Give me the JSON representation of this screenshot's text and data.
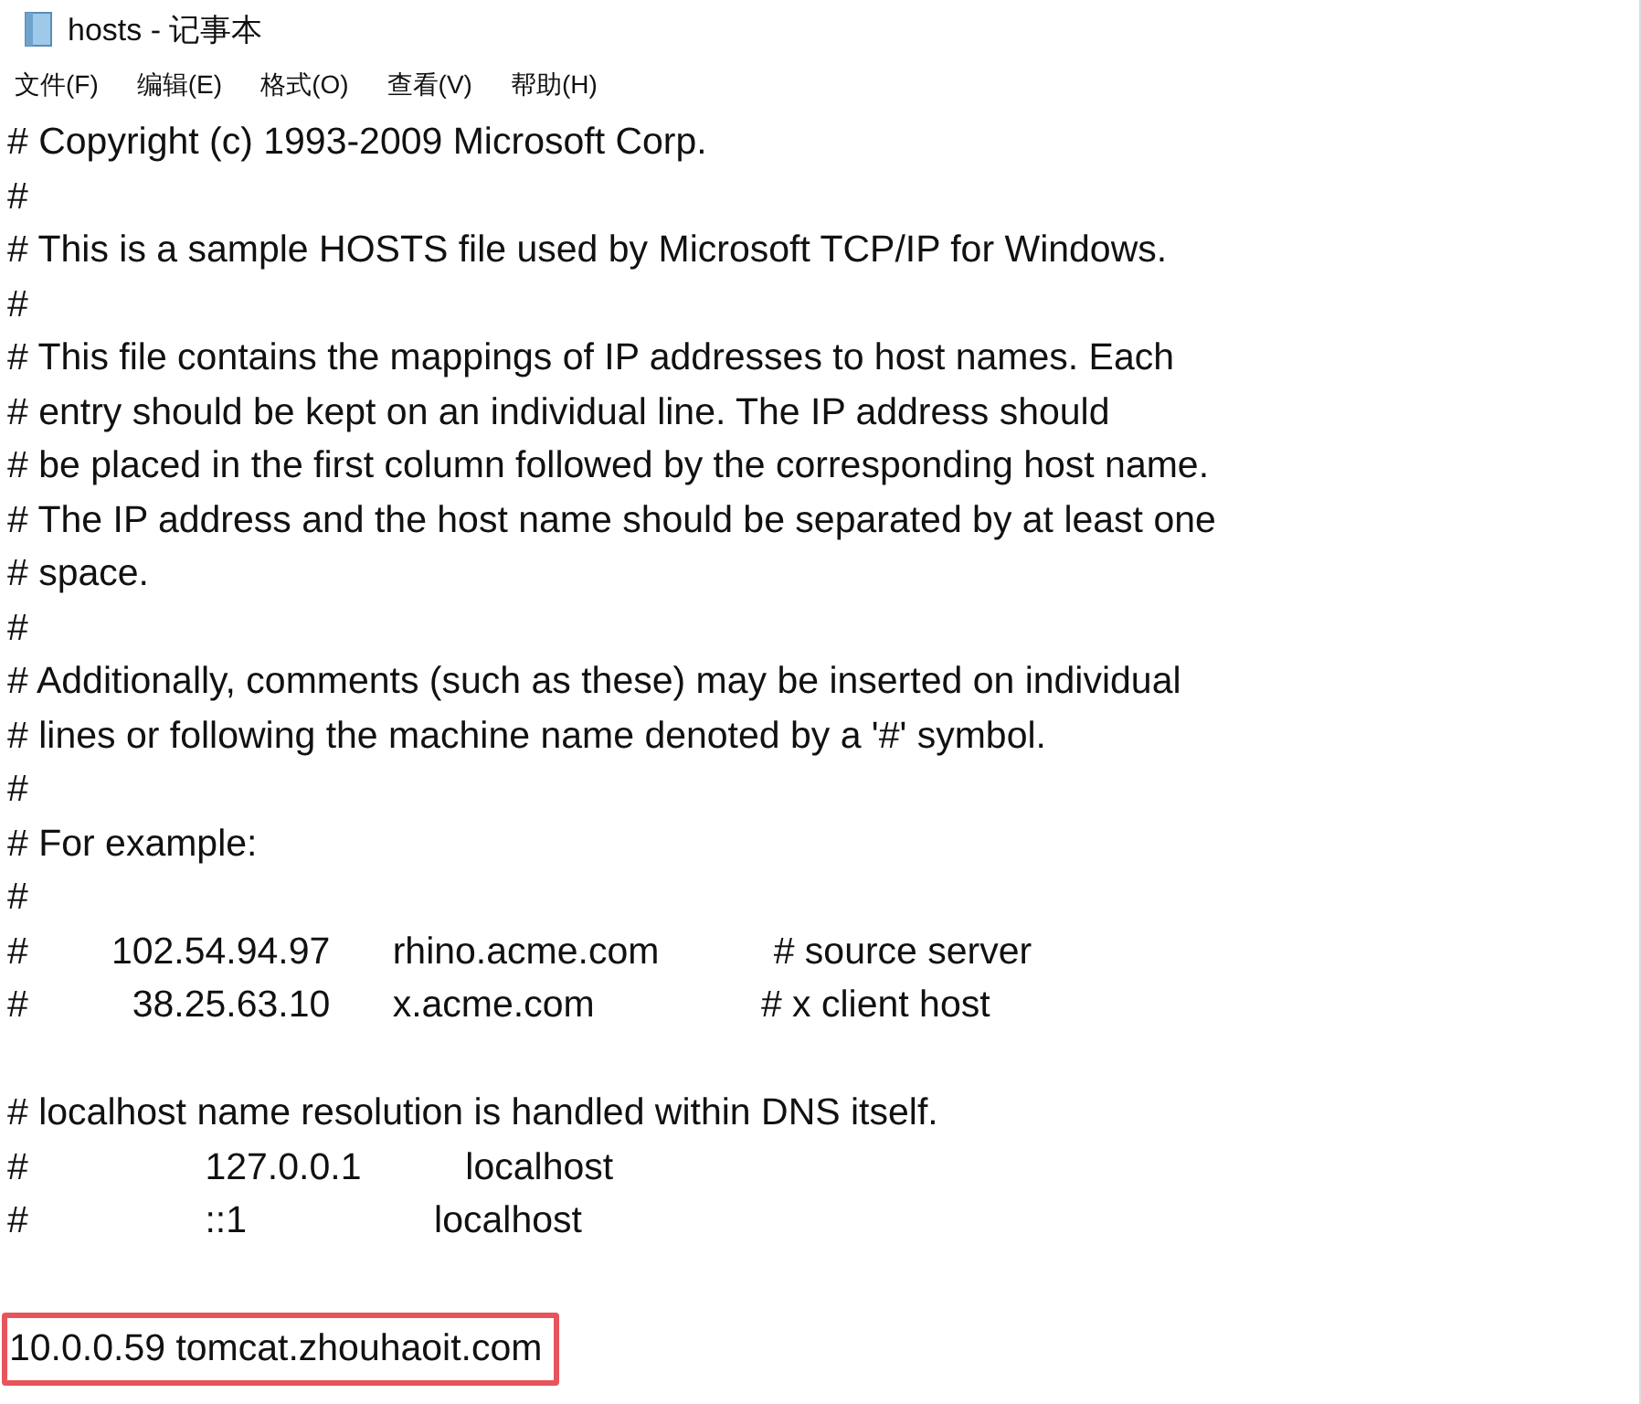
{
  "window": {
    "title": "hosts - 记事本"
  },
  "menu": [
    "文件(F)",
    "编辑(E)",
    "格式(O)",
    "查看(V)",
    "帮助(H)"
  ],
  "lines": [
    {
      "kind": "text",
      "text": "# Copyright (c) 1993-2009 Microsoft Corp."
    },
    {
      "kind": "text",
      "text": "#"
    },
    {
      "kind": "text",
      "text": "# This is a sample HOSTS file used by Microsoft TCP/IP for Windows."
    },
    {
      "kind": "text",
      "text": "#"
    },
    {
      "kind": "text",
      "text": "# This file contains the mappings of IP addresses to host names. Each"
    },
    {
      "kind": "text",
      "text": "# entry should be kept on an individual line. The IP address should"
    },
    {
      "kind": "text",
      "text": "# be placed in the first column followed by the corresponding host name."
    },
    {
      "kind": "text",
      "text": "# The IP address and the host name should be separated by at least one"
    },
    {
      "kind": "text",
      "text": "# space."
    },
    {
      "kind": "text",
      "text": "#"
    },
    {
      "kind": "text",
      "text": "# Additionally, comments (such as these) may be inserted on individual"
    },
    {
      "kind": "text",
      "text": "# lines or following the machine name denoted by a '#' symbol."
    },
    {
      "kind": "text",
      "text": "#"
    },
    {
      "kind": "text",
      "text": "# For example:"
    },
    {
      "kind": "text",
      "text": "#"
    },
    {
      "kind": "text",
      "text": "#        102.54.94.97      rhino.acme.com           # source server"
    },
    {
      "kind": "text",
      "text": "#          38.25.63.10      x.acme.com                # x client host"
    },
    {
      "kind": "blank"
    },
    {
      "kind": "text",
      "text": "# localhost name resolution is handled within DNS itself."
    },
    {
      "kind": "text",
      "text": "#                 127.0.0.1          localhost"
    },
    {
      "kind": "text",
      "text": "#                 ::1                  localhost"
    },
    {
      "kind": "blank"
    },
    {
      "kind": "highlighted",
      "text": "10.0.0.59 tomcat.zhouhaoit.com"
    }
  ]
}
